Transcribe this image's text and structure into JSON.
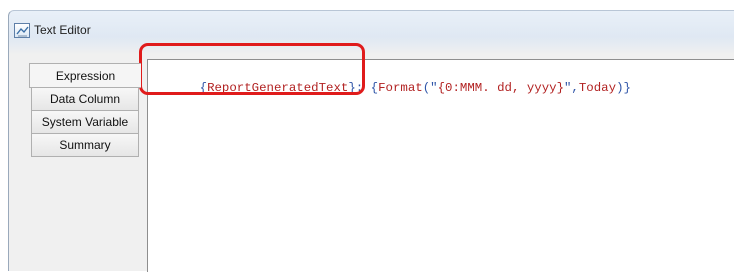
{
  "window": {
    "title": "Text Editor",
    "icon": "text-editor-icon"
  },
  "tabs": [
    {
      "label": "Expression",
      "selected": true
    },
    {
      "label": "Data Column"
    },
    {
      "label": "System Variable"
    },
    {
      "label": "Summary"
    }
  ],
  "editor": {
    "tokens": [
      {
        "text": "{",
        "kind": "brace"
      },
      {
        "text": "ReportGeneratedText",
        "kind": "name"
      },
      {
        "text": "}",
        "kind": "brace"
      },
      {
        "text": ": ",
        "kind": "plain"
      },
      {
        "text": "{",
        "kind": "brace"
      },
      {
        "text": "Format",
        "kind": "name"
      },
      {
        "text": "(\"",
        "kind": "plain"
      },
      {
        "text": "{0:MMM. dd, yyyy}",
        "kind": "name"
      },
      {
        "text": "\",",
        "kind": "plain"
      },
      {
        "text": "Today",
        "kind": "name"
      },
      {
        "text": ")",
        "kind": "plain"
      },
      {
        "text": "}",
        "kind": "brace"
      }
    ]
  },
  "annotation": {
    "color": "#e01b1b"
  }
}
